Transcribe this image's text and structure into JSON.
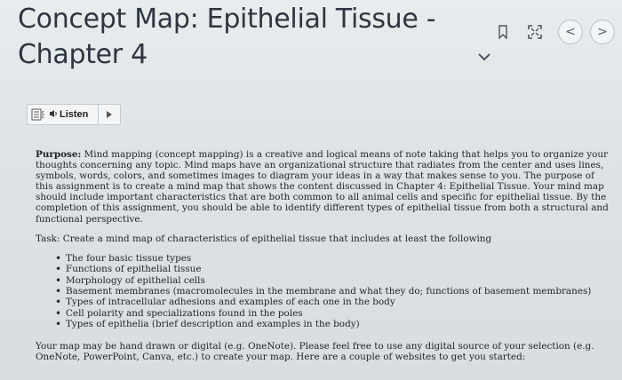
{
  "page": {
    "title_line1": "Concept Map: Epithelial Tissue -",
    "title_line2": "Chapter 4"
  },
  "toolbar": {
    "listen_label": "Listen",
    "prev_glyph": "<",
    "next_glyph": ">",
    "expand_glyph": "⌄"
  },
  "content": {
    "purpose_label": "Purpose:",
    "purpose_text": " Mind mapping (concept mapping) is a creative and logical means of note taking that helps you to organize your thoughts concerning any topic. Mind maps have an organizational structure that radiates from the center and uses lines, symbols, words, colors, and sometimes images to diagram your ideas in a way that makes sense to you. The purpose of this assignment is to create a mind map that shows the content discussed in Chapter 4: Epithelial Tissue. Your mind map should include important characteristics that are both common to all animal cells and specific for epithelial tissue. By the completion of this assignment, you should be able to identify different types of epithelial tissue from both a structural and functional perspective.",
    "task_text": "Task: Create a mind map of characteristics of epithelial tissue that includes at least the following",
    "items": [
      "The four basic tissue types",
      "Functions of epithelial tissue",
      "Morphology of epithelial cells",
      "Basement membranes (macromolecules in the membrane and what they do; functions of basement membranes)",
      "Types of intracellular adhesions and examples of each one in the body",
      "Cell polarity and specializations found in the poles",
      "Types of epithelia (brief description and examples in the body)"
    ],
    "closing_text": "Your map may be hand drawn or digital (e.g. OneNote). Please feel free to use any digital source of your selection (e.g. OneNote, PowerPoint, Canva, etc.) to create your map. Here are a couple of websites to get you started:"
  },
  "colors": {
    "background": "#dfe3e6",
    "title": "#2d3640",
    "text": "#1f2326"
  }
}
